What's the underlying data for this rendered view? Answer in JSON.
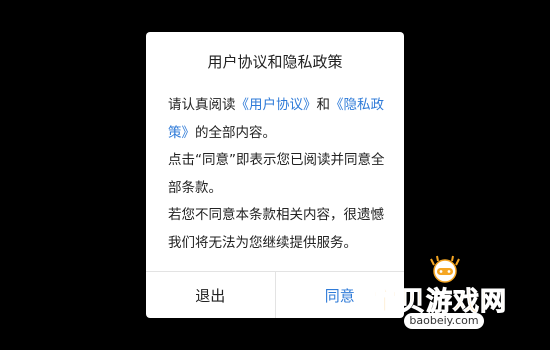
{
  "dialog": {
    "title": "用户协议和隐私政策",
    "body": {
      "p1_before": "请认真阅读",
      "p1_link1": "《用户协议》",
      "p1_and": "和",
      "p1_link2": "《隐私政策》",
      "p1_after": "的全部内容。",
      "p2": "点击“同意”即表示您已阅读并同意全部条款。",
      "p3": "若您不同意本条款相关内容，很遗憾我们将无法为您继续提供服务。"
    },
    "buttons": {
      "exit": "退出",
      "agree": "同意"
    }
  },
  "watermark": {
    "text": "宝贝游戏网",
    "url": "baobeiy.com"
  },
  "colors": {
    "link": "#2f7bd8",
    "watermark": "#f5a623"
  }
}
